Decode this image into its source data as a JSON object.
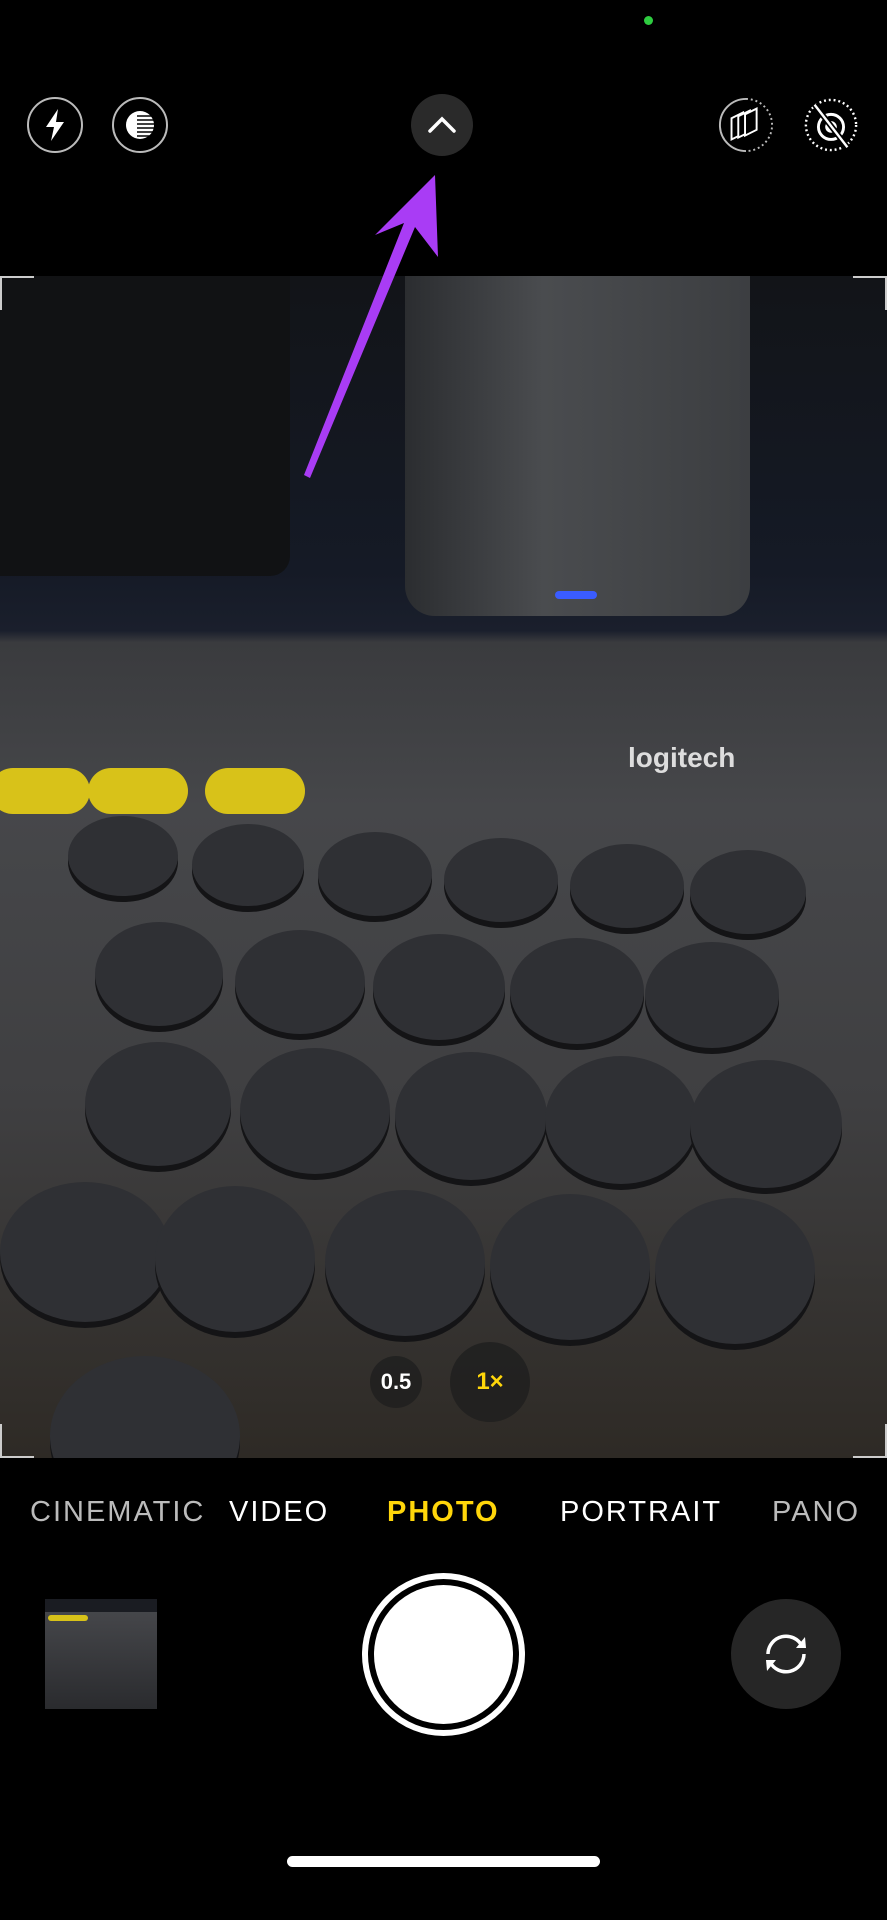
{
  "status": {
    "camera_in_use_indicator_color": "#2ecc40"
  },
  "top_controls": [
    {
      "name": "flash",
      "icon": "flash-icon"
    },
    {
      "name": "night-mode",
      "icon": "night-mode-icon"
    },
    {
      "name": "expand-controls",
      "icon": "chevron-up-icon"
    },
    {
      "name": "live-photo",
      "icon": "live-photo-icon"
    },
    {
      "name": "photographic-styles",
      "icon": "styles-off-icon"
    }
  ],
  "annotation": {
    "arrow_color": "#a93cf5",
    "points_to": "expand-controls"
  },
  "viewfinder": {
    "keyboard_brand": "logitech"
  },
  "zoom": {
    "options": [
      "0.5",
      "1×"
    ],
    "selected": "1×"
  },
  "modes": {
    "items": [
      "CINEMATIC",
      "VIDEO",
      "PHOTO",
      "PORTRAIT",
      "PANO"
    ],
    "selected": "PHOTO",
    "accent": "#ffd60a"
  },
  "bottom": {
    "shutter": "shutter-button",
    "thumbnail": "last-photo-thumbnail",
    "flip": "switch-camera-icon"
  }
}
